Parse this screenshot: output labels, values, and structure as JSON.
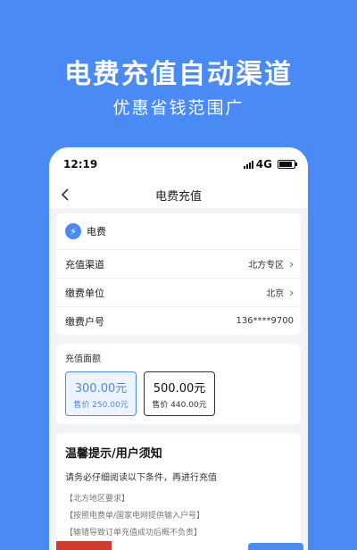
{
  "promo": {
    "title": "电费充值自动渠道",
    "subtitle": "优惠省钱范围广"
  },
  "status_bar": {
    "time": "12:19",
    "network": "4G"
  },
  "nav": {
    "title": "电费充值"
  },
  "service": {
    "name": "电费",
    "icon": "bolt-icon"
  },
  "info_rows": [
    {
      "label": "充值渠道",
      "value": "北方专区",
      "has_chevron": true
    },
    {
      "label": "缴费单位",
      "value": "北京",
      "has_chevron": true
    },
    {
      "label": "缴费户号",
      "value": "136****9700",
      "has_chevron": false
    }
  ],
  "amount": {
    "label": "充值面额",
    "options": [
      {
        "face": "300.00元",
        "price": "售价 250.00元",
        "selected": true
      },
      {
        "face": "500.00元",
        "price": "售价 440.00元",
        "selected": false
      }
    ]
  },
  "notice": {
    "title": "温馨提示/用户须知",
    "intro": "请务必仔细阅读以下条件，再进行充值",
    "items": [
      "【北方地区要求】",
      "【按照电费单/国家电网提供输入户号】",
      "【输错导致订单充值成功后概不负责】"
    ]
  },
  "colors": {
    "accent": "#4a8af4",
    "background": "#f2f3f7"
  }
}
